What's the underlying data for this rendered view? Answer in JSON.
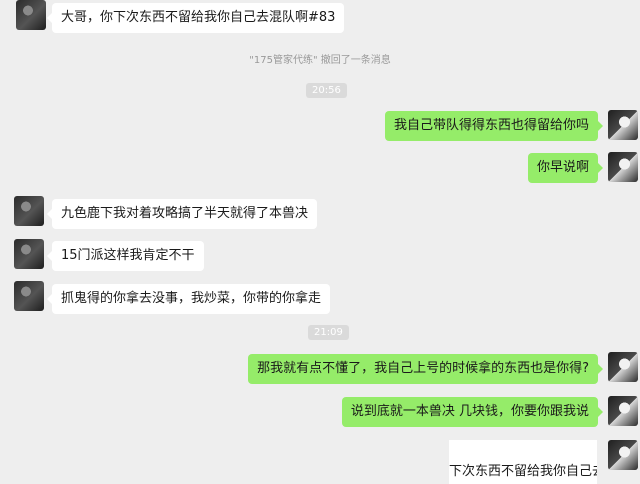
{
  "messages": [
    {
      "side": "left",
      "text": "大哥，你下次东西不留给我你自己去混队啊#83"
    },
    {
      "side": "right",
      "text": "我自己带队得得东西也得留给你吗"
    },
    {
      "side": "right",
      "text": "你早说啊"
    },
    {
      "side": "left",
      "text": "九色鹿下我对着攻略搞了半天就得了本兽决"
    },
    {
      "side": "left",
      "text": "15门派这样我肯定不干"
    },
    {
      "side": "left",
      "text": "抓鬼得的你拿去没事，我炒菜，你带的你拿走"
    },
    {
      "side": "right",
      "text": "那我就有点不懂了，我自己上号的时候拿的东西也是你得?"
    },
    {
      "side": "right",
      "text": "说到底就一本兽决 几块钱，你要你跟我说"
    }
  ],
  "system": {
    "recall": "\"175管家代练\" 撤回了一条消息",
    "time1": "20:56",
    "time2": "21:09"
  },
  "preview_card": {
    "text": "下次东西不留给我你自己去"
  }
}
